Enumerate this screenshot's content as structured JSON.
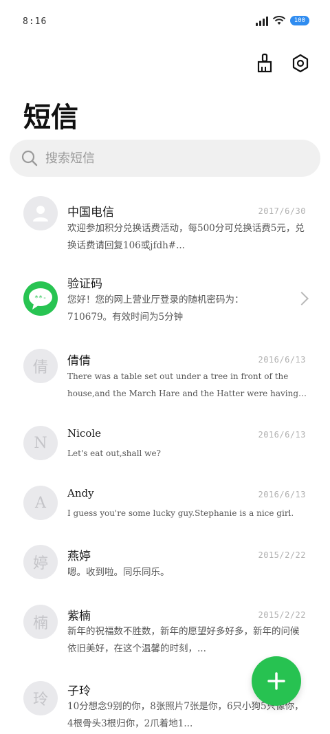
{
  "status": {
    "time": "8:16",
    "battery": "100"
  },
  "header": {
    "title": "短信",
    "clean_icon": "broom-icon",
    "settings_icon": "gear-icon"
  },
  "search": {
    "placeholder": "搜索短信"
  },
  "messages": [
    {
      "name": "中国电信",
      "avatar": "",
      "date": "2017/6/30",
      "preview": "欢迎参加积分兑换话费活动，每500分可兑换话费5元，兑换话费请回复106或jfdh#..."
    },
    {
      "name": "验证码",
      "avatar": "**-",
      "date": "",
      "preview": "您好！您的网上营业厅登录的随机密码为：710679。有效时间为5分钟"
    },
    {
      "name": "倩倩",
      "avatar": "倩",
      "date": "2016/6/13",
      "preview": "There was a table set out under a tree in front of the house,and the March Hare and the Hatter were having ..."
    },
    {
      "name": "Nicole",
      "avatar": "N",
      "date": "2016/6/13",
      "preview": "Let's eat out,shall we?"
    },
    {
      "name": "Andy",
      "avatar": "A",
      "date": "2016/6/13",
      "preview": "I guess you're some lucky guy.Stephanie is a nice girl."
    },
    {
      "name": "燕婷",
      "avatar": "婷",
      "date": "2015/2/22",
      "preview": "嗯。收到啦。同乐同乐。"
    },
    {
      "name": "紫楠",
      "avatar": "楠",
      "date": "2015/2/22",
      "preview": "新年的祝福数不胜数，新年的愿望好多好多，新年的问候依旧美好，在这个温馨的时刻，..."
    },
    {
      "name": "子玲",
      "avatar": "玲",
      "date": "",
      "preview": "10分想念9别的你，8张照片7张是你，6只小狗5只像你，4根骨头3根归你，2爪着地1..."
    }
  ],
  "fab": {
    "icon": "plus-icon"
  }
}
